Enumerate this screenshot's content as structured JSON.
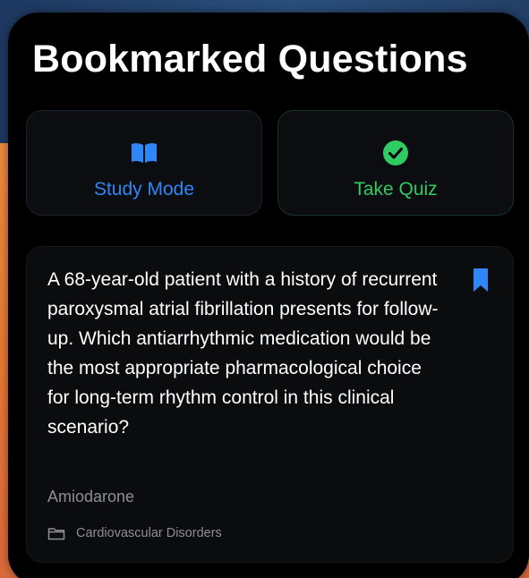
{
  "page": {
    "title": "Bookmarked Questions"
  },
  "actions": {
    "study_mode": {
      "label": "Study Mode",
      "icon": "book-icon",
      "color": "#2f86f6"
    },
    "take_quiz": {
      "label": "Take Quiz",
      "icon": "checkmark-circle-icon",
      "color": "#2fcb63"
    }
  },
  "bookmarked": [
    {
      "question": "A 68-year-old patient with a history of recurrent paroxysmal atrial fibrillation presents for follow-up. Which antiarrhythmic medication would be the most appropriate pharmacological choice for long-term rhythm control in this clinical scenario?",
      "answer": "Amiodarone",
      "category": "Cardiovascular Disorders",
      "bookmark_icon": "bookmark-icon",
      "category_icon": "folder-icon"
    }
  ]
}
